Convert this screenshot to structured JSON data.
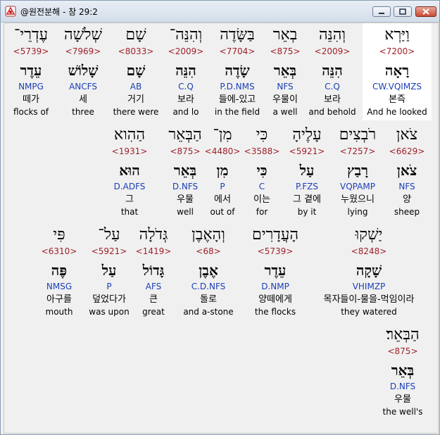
{
  "window": {
    "title": "@원전분해 - 창 29:2"
  },
  "rows": [
    [
      {
        "heb": "וַיַּרְא",
        "strong": "<7200>",
        "lemma": "רָאָה",
        "parse": "CW.VQIMZS",
        "kor": "본즉",
        "eng": "And he looked"
      },
      {
        "heb": "וְהִנֵּה",
        "strong": "<2009>",
        "lemma": "הִנֵּה",
        "parse": "C.Q",
        "kor": "보라",
        "eng": "and behold"
      },
      {
        "heb": "בְאֵר",
        "strong": "<875>",
        "lemma": "בְּאֵר",
        "parse": "NFS",
        "kor": "우물이",
        "eng": "a well"
      },
      {
        "heb": "בַּשָּׂדֶה",
        "strong": "<7704>",
        "lemma": "שָׂדֶה",
        "parse": "P.D.NMS",
        "kor": "들에-있고",
        "eng": "in the field"
      },
      {
        "heb": "וְהִנֵּה־",
        "strong": "<2009>",
        "lemma": "הִנֵּה",
        "parse": "C.Q",
        "kor": "보라",
        "eng": "and lo"
      },
      {
        "heb": "שָׁם",
        "strong": "<8033>",
        "lemma": "שָׁם",
        "parse": "AB",
        "kor": "거기",
        "eng": "there were"
      },
      {
        "heb": "שְׁלֹשָׁה",
        "strong": "<7969>",
        "lemma": "שָׁלוֹשׁ",
        "parse": "ANCFS",
        "kor": "세",
        "eng": "three"
      },
      {
        "heb": "עֶדְרֵי־",
        "strong": "<5739>",
        "lemma": "עֵדֶר",
        "parse": "NMPG",
        "kor": "떼가",
        "eng": "flocks of"
      }
    ],
    [
      {
        "heb": "צֹאן",
        "strong": "<6629>",
        "lemma": "צֹאן",
        "parse": "NFS",
        "kor": "양",
        "eng": "sheep"
      },
      {
        "heb": "רֹבְצִים",
        "strong": "<7257>",
        "lemma": "רָבַץ",
        "parse": "VQPAMP",
        "kor": "누웠으니",
        "eng": "lying"
      },
      {
        "heb": "עָלֶיהָ",
        "strong": "<5921>",
        "lemma": "עַל",
        "parse": "P.FZS",
        "kor": "그 곁에",
        "eng": "by it"
      },
      {
        "heb": "כִּי",
        "strong": "<3588>",
        "lemma": "כִּי",
        "parse": "C",
        "kor": "이는",
        "eng": "for"
      },
      {
        "heb": "מִן־",
        "strong": "<4480>",
        "lemma": "מִן",
        "parse": "P",
        "kor": "에서",
        "eng": "out of"
      },
      {
        "heb": "הַבְּאֵר",
        "strong": "<875>",
        "lemma": "בְּאֵר",
        "parse": "D.NFS",
        "kor": "우물",
        "eng": "well"
      },
      {
        "heb": "הַהִוא",
        "strong": "<1931>",
        "lemma": "הוּא",
        "parse": "D.ADFS",
        "kor": "그",
        "eng": "that"
      }
    ],
    [
      {
        "heb": "יַשְׁקוּ",
        "strong": "<8248>",
        "lemma": "שָׁקָה",
        "parse": "VHIMZP",
        "kor": "목자들이-물을-먹임이라",
        "eng": "they watered"
      },
      {
        "heb": "הָעֲדָרִים",
        "strong": "<5739>",
        "lemma": "עֵדֶר",
        "parse": "D.NMP",
        "kor": "양떼에게",
        "eng": "the flocks"
      },
      {
        "heb": "וְהָאֶבֶן",
        "strong": "<68>",
        "lemma": "אֶבֶן",
        "parse": "C.D.NFS",
        "kor": "돌로",
        "eng": "and a-stone"
      },
      {
        "heb": "גְּדֹלָה",
        "strong": "<1419>",
        "lemma": "גָּדוֹל",
        "parse": "AFS",
        "kor": "큰",
        "eng": "great"
      },
      {
        "heb": "עַל־",
        "strong": "<5921>",
        "lemma": "עַל",
        "parse": "P",
        "kor": "덮었다가",
        "eng": "was upon"
      },
      {
        "heb": "פִּי",
        "strong": "<6310>",
        "lemma": "פֶּה",
        "parse": "NMSG",
        "kor": "아구를",
        "eng": "mouth"
      }
    ],
    [
      {
        "heb": "הַבְּאֵר׃",
        "strong": "<875>",
        "lemma": "בְּאֵר",
        "parse": "D.NFS",
        "kor": "우물",
        "eng": "the well's"
      }
    ]
  ]
}
